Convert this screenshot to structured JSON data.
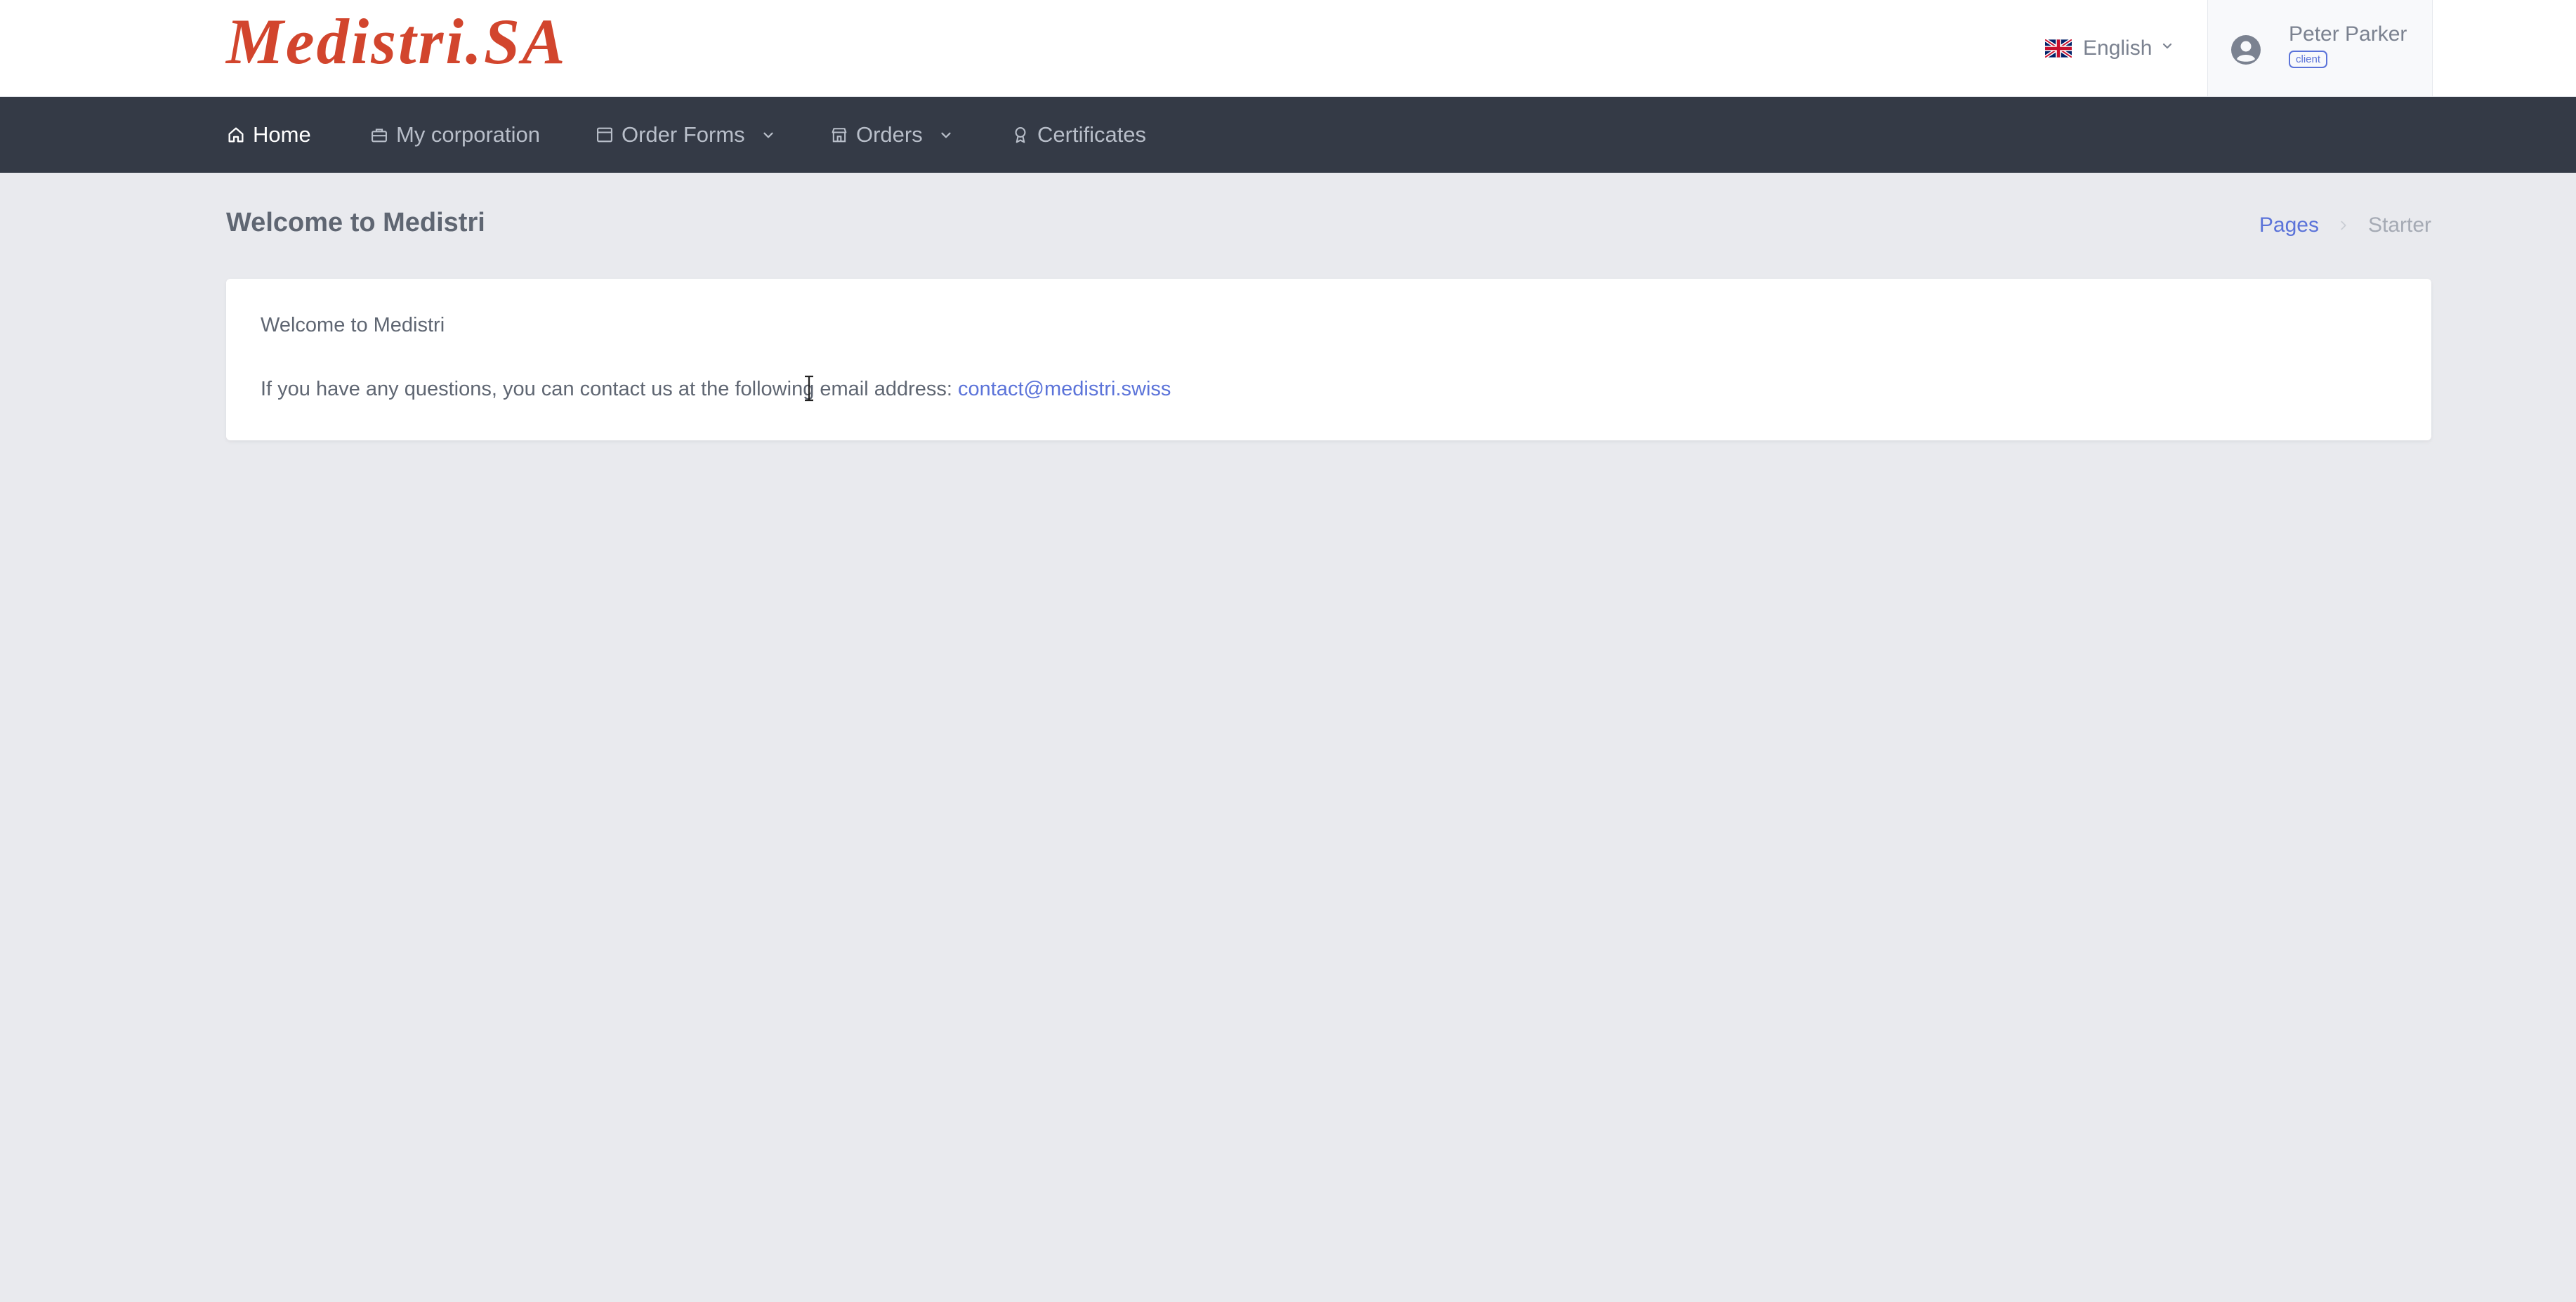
{
  "header": {
    "logo_text": "Medistri.SA",
    "language": {
      "flag_icon": "uk-flag-icon",
      "label": "English"
    },
    "user": {
      "name": "Peter Parker",
      "role": "client"
    }
  },
  "nav": {
    "items": [
      {
        "label": "Home",
        "icon": "home-icon",
        "active": true,
        "dropdown": false
      },
      {
        "label": "My corporation",
        "icon": "briefcase-icon",
        "active": false,
        "dropdown": false
      },
      {
        "label": "Order Forms",
        "icon": "window-icon",
        "active": false,
        "dropdown": true
      },
      {
        "label": "Orders",
        "icon": "store-icon",
        "active": false,
        "dropdown": true
      },
      {
        "label": "Certificates",
        "icon": "award-icon",
        "active": false,
        "dropdown": false
      }
    ]
  },
  "page": {
    "title": "Welcome to Medistri",
    "breadcrumb": {
      "parent": "Pages",
      "current": "Starter"
    }
  },
  "card": {
    "heading": "Welcome to Medistri",
    "contact_text": "If you have any questions, you can contact us at the following email address: ",
    "email": "contact@medistri.swiss"
  },
  "colors": {
    "brand": "#d2452d",
    "accent": "#5b73d9",
    "navbar_bg": "#343a46",
    "page_bg": "#e9eaee"
  }
}
